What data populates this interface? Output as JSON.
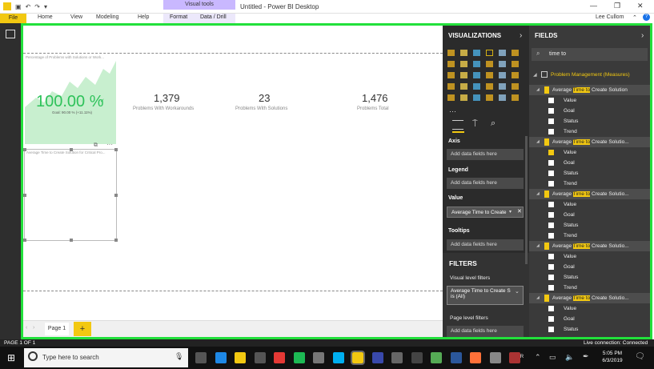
{
  "window": {
    "title": "Untitled - Power BI Desktop",
    "contextual_tab": "Visual tools",
    "user": "Lee Cullom",
    "controls": [
      "minimize-icon",
      "restore-icon",
      "close-icon"
    ]
  },
  "ribbon": {
    "file": "File",
    "tabs": [
      "Home",
      "View",
      "Modeling",
      "Help",
      "Format",
      "Data / Drill"
    ]
  },
  "canvas": {
    "visual1_title": "Percentage of Problems with Solutions or Work...",
    "gauge_value": "100.00 %",
    "gauge_goal": "Goal: 90.00 % (+11.11%)",
    "cards": [
      {
        "value": "1,379",
        "label": "Problems With Workarounds"
      },
      {
        "value": "23",
        "label": "Problems With Solutions"
      },
      {
        "value": "1,476",
        "label": "Problems Total"
      }
    ],
    "selected_visual_title": "Average Time to Create Solution for Critical Pro...",
    "page_tab": "Page 1",
    "add_page": "+"
  },
  "visualizations": {
    "header": "VISUALIZATIONS",
    "wells": [
      {
        "label": "Axis",
        "value": "Add data fields here"
      },
      {
        "label": "Legend",
        "value": "Add data fields here"
      },
      {
        "label": "Value",
        "value": "Average Time to Create"
      },
      {
        "label": "Tooltips",
        "value": "Add data fields here"
      }
    ],
    "filters_header": "FILTERS",
    "visual_level_filters": "Visual level filters",
    "filter_item_line1": "Average Time to Create S",
    "filter_item_line2": "is (All)",
    "page_level_filters": "Page level filters",
    "page_level_placeholder": "Add data fields here"
  },
  "fields": {
    "header": "FIELDS",
    "search_value": "time to",
    "table_name": "Problem Management (Measures)",
    "groups": [
      {
        "pre": "Average ",
        "hl": "Time to",
        "post": " Create Solution",
        "items": [
          "Value",
          "Goal",
          "Status",
          "Trend"
        ]
      },
      {
        "pre": "Average ",
        "hl": "Time to",
        "post": " Create Solutio...",
        "items": [
          "Value",
          "Goal",
          "Status",
          "Trend"
        ]
      },
      {
        "pre": "Average ",
        "hl": "Time to",
        "post": " Create Solutio...",
        "items": [
          "Value",
          "Goal",
          "Status",
          "Trend"
        ]
      },
      {
        "pre": "Average ",
        "hl": "Time to",
        "post": " Create Solutio...",
        "items": [
          "Value",
          "Goal",
          "Status",
          "Trend"
        ]
      },
      {
        "pre": "Average ",
        "hl": "Time to",
        "post": " Create Solutio...",
        "items": [
          "Value",
          "Goal",
          "Status"
        ]
      }
    ]
  },
  "status": {
    "page": "PAGE 1 OF 1",
    "connection": "Live connection: Connected"
  },
  "taskbar": {
    "search_placeholder": "Type here to search",
    "time": "5:05 PM",
    "date": "6/3/2019"
  },
  "colors": {
    "accent_yellow": "#f2c811",
    "selection_green": "#22e03b",
    "gauge_green": "#2ec25a"
  }
}
